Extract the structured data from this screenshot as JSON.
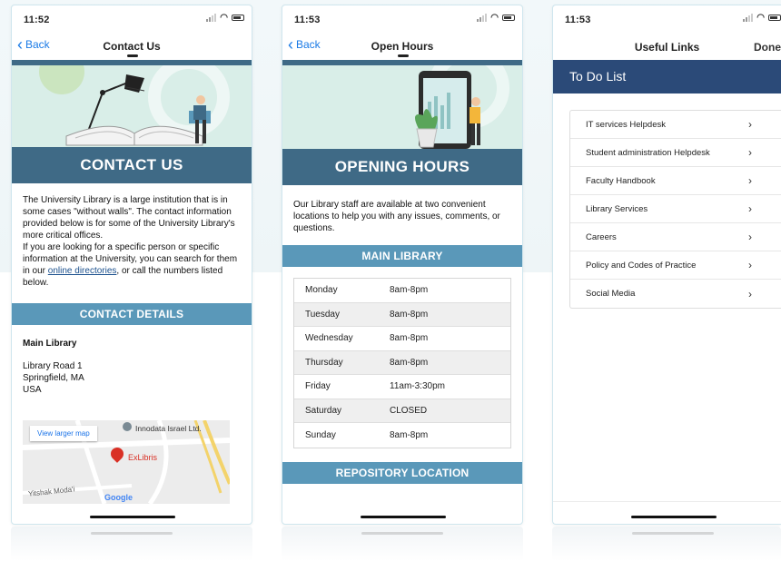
{
  "screens": {
    "contact": {
      "status_time": "11:52",
      "back_label": "Back",
      "title": "Contact Us",
      "banner": "CONTACT US",
      "paragraph1": "The University Library is a large institution that is in some cases \"without walls\". The contact information provided below is for some of the University Library's more critical offices.",
      "paragraph2_pre": "If you are looking for a specific person or specific information at the University, you can search for them in our ",
      "paragraph2_link": "online directories",
      "paragraph2_post": ", or call the numbers listed below.",
      "section": "CONTACT DETAILS",
      "location_name": "Main Library",
      "address_line1": "Library Road 1",
      "address_line2": "Springfield, MA",
      "address_line3": "USA",
      "map": {
        "larger_map": "View larger map",
        "poi1": "Innodata Israel Ltd.",
        "poi2": "ExLibris",
        "street": "Yitshak Moda'i",
        "google": "Google"
      }
    },
    "hours": {
      "status_time": "11:53",
      "back_label": "Back",
      "title": "Open Hours",
      "banner": "OPENING HOURS",
      "intro": "Our Library staff are available at two convenient locations to help you with any issues, comments, or questions.",
      "section1": "MAIN LIBRARY",
      "rows": [
        {
          "day": "Monday",
          "time": "8am-8pm"
        },
        {
          "day": "Tuesday",
          "time": "8am-8pm"
        },
        {
          "day": "Wednesday",
          "time": "8am-8pm"
        },
        {
          "day": "Thursday",
          "time": "8am-8pm"
        },
        {
          "day": "Friday",
          "time": "11am-3:30pm"
        },
        {
          "day": "Saturday",
          "time": "CLOSED"
        },
        {
          "day": "Sunday",
          "time": "8am-8pm"
        }
      ],
      "section2": "REPOSITORY LOCATION"
    },
    "links": {
      "status_time": "11:53",
      "title": "Useful Links",
      "done_label": "Done",
      "header": "To Do List",
      "items": [
        {
          "label": "IT services Helpdesk"
        },
        {
          "label": "Student administration Helpdesk"
        },
        {
          "label": "Faculty Handbook"
        },
        {
          "label": "Library Services"
        },
        {
          "label": "Careers"
        },
        {
          "label": "Policy and Codes of Practice"
        },
        {
          "label": "Social Media"
        }
      ],
      "chevron": "›"
    }
  },
  "colors": {
    "banner": "#3f6a86",
    "section": "#5a98b9",
    "todo_header": "#2b4a78",
    "link": "#1a7ae6"
  }
}
